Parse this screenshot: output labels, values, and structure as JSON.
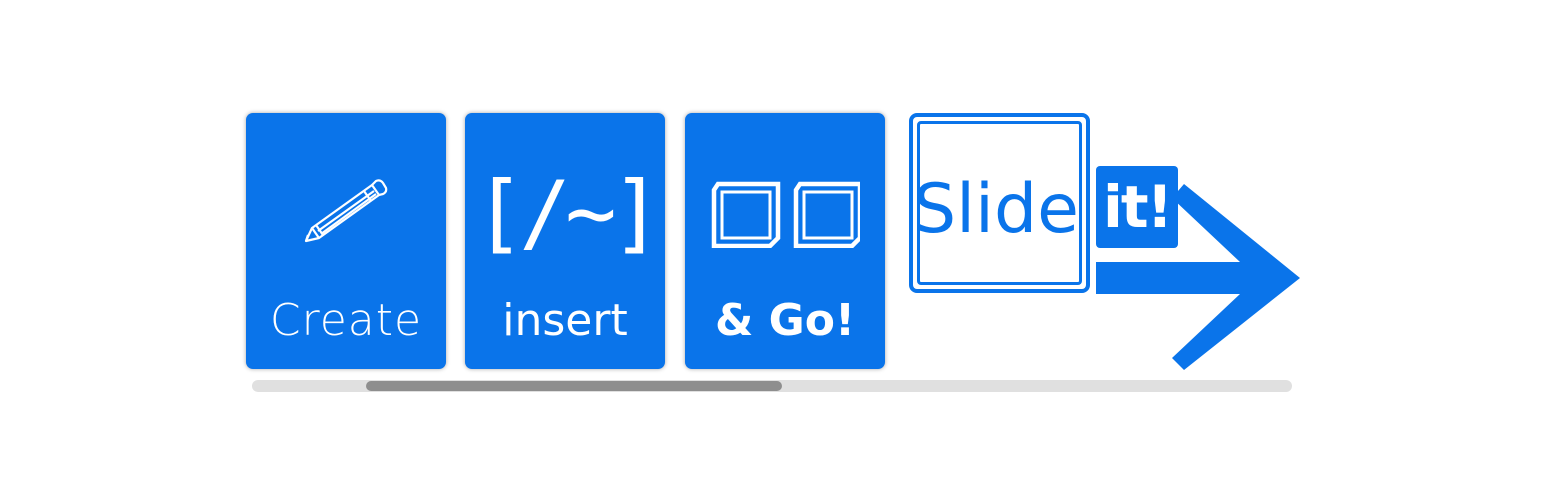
{
  "colors": {
    "brand_blue": "#0a74ea",
    "card_text": "#ffffff",
    "scroll_track": "#e0e0e0",
    "scroll_thumb": "#8e8e8e"
  },
  "cards": [
    {
      "label": "Create",
      "icon": "pencil-icon"
    },
    {
      "label": "insert",
      "icon": "bracket-slash-tilde-icon",
      "icon_text": "[/~]"
    },
    {
      "label": "& Go!",
      "icon": "two-slides-icon"
    }
  ],
  "logo": {
    "word": "Slide",
    "badge": "it!",
    "icon": "right-arrow-icon"
  },
  "scrollbar": {
    "position_fraction": 0.11,
    "visible_fraction": 0.4
  }
}
